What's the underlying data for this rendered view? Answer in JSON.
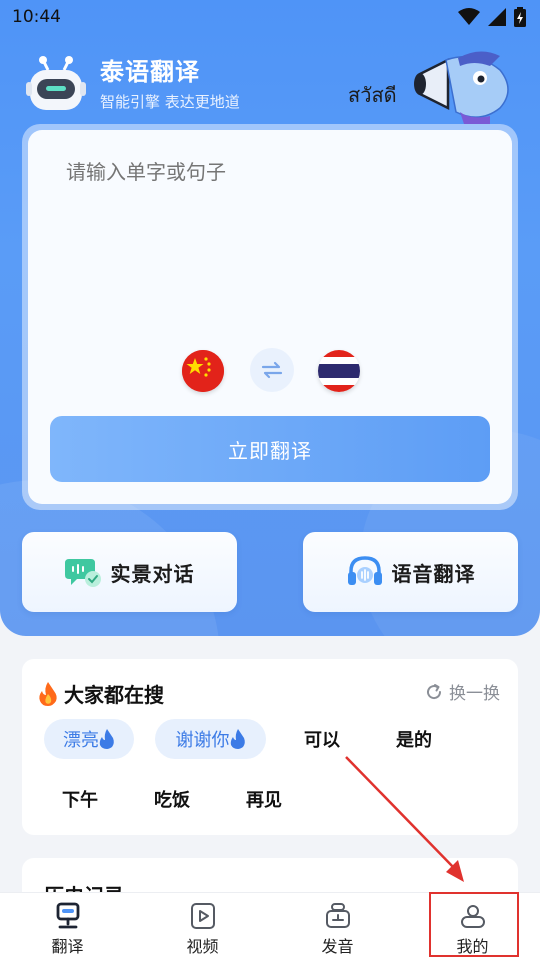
{
  "status_bar": {
    "time": "10:44"
  },
  "brand": {
    "title": "泰语翻译",
    "subtitle": "智能引擎 表达更地道"
  },
  "mascot": {
    "greeting": "สวัสดี"
  },
  "input": {
    "placeholder": "请输入单字或句子",
    "value": ""
  },
  "languages": {
    "source": "chinese-flag",
    "target": "thai-flag"
  },
  "translate_button": {
    "label": "立即翻译"
  },
  "features": [
    {
      "label": "实景对话",
      "icon": "chat-bubble-icon"
    },
    {
      "label": "语音翻译",
      "icon": "headphones-icon"
    }
  ],
  "hot_search": {
    "title": "大家都在搜",
    "refresh_label": "换一换",
    "tags": [
      {
        "text": "漂亮",
        "hot": true
      },
      {
        "text": "谢谢你",
        "hot": true
      },
      {
        "text": "可以",
        "hot": false
      },
      {
        "text": "是的",
        "hot": false
      },
      {
        "text": "下午",
        "hot": false
      },
      {
        "text": "吃饭",
        "hot": false
      },
      {
        "text": "再见",
        "hot": false
      }
    ]
  },
  "history": {
    "title": "历史记录"
  },
  "nav": [
    {
      "label": "翻译",
      "icon": "translate-tab-icon",
      "active": true
    },
    {
      "label": "视频",
      "icon": "video-play-icon",
      "active": false
    },
    {
      "label": "发音",
      "icon": "pronunciation-icon",
      "active": false
    },
    {
      "label": "我的",
      "icon": "profile-icon",
      "active": false
    }
  ],
  "colors": {
    "accent": "#4f94f7",
    "annotation": "#e0322e"
  }
}
